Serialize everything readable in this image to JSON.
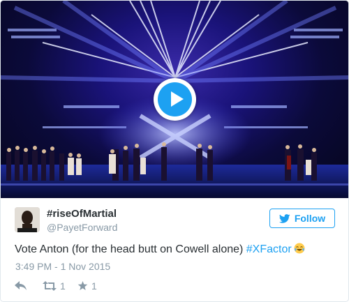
{
  "tweet": {
    "display_name": "#riseOfMartial",
    "screen_name": "@PayetForward",
    "follow_label": "Follow",
    "text_before": "Vote Anton (for the head butt on Cowell alone) ",
    "hashtag": "#XFactor",
    "emoji": "face-with-tears-of-joy",
    "timestamp": "3:49 PM - 1 Nov 2015",
    "retweet_count": "1",
    "like_count": "1"
  },
  "media": {
    "type": "video",
    "play_icon": "play-icon"
  },
  "icons": {
    "reply": "reply-icon",
    "retweet": "retweet-icon",
    "like": "star-icon",
    "follow": "twitter-bird-icon"
  },
  "colors": {
    "accent": "#1da1f2",
    "muted": "#8899a6",
    "text": "#292f33",
    "border": "#e1e8ed"
  }
}
